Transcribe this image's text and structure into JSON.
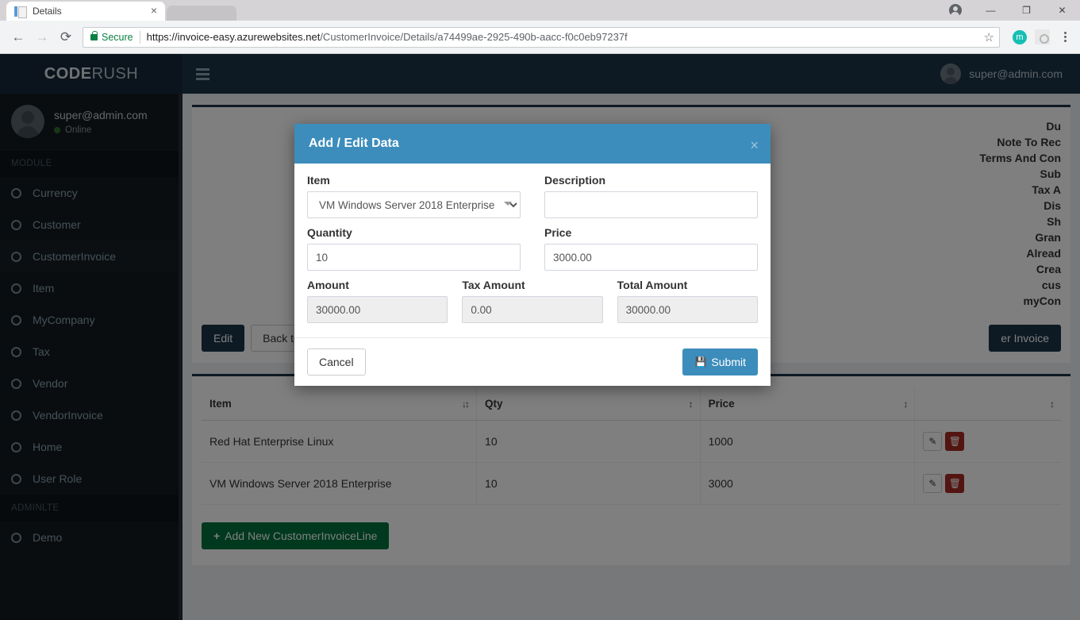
{
  "browser": {
    "tab_title": "Details",
    "tab_close": "×",
    "back_icon": "←",
    "forward_icon": "→",
    "reload_icon": "⟳",
    "secure_label": "Secure",
    "url_scheme_host": "https://invoice-easy.azurewebsites.net",
    "url_path": "/CustomerInvoice/Details/a74499ae-2925-490b-aacc-f0c0eb97237f",
    "star_icon": "☆",
    "extension_letter": "m",
    "window_minimize": "—",
    "window_maximize": "❐",
    "window_close": "✕"
  },
  "navbar": {
    "logo_bold": "CODE",
    "logo_light": "RUSH",
    "user_email": "super@admin.com"
  },
  "sidebar": {
    "user_name": "super@admin.com",
    "user_status": "Online",
    "section_module": "MODULE",
    "section_adminlte": "ADMINLTE",
    "items": [
      {
        "label": "Currency",
        "active": false
      },
      {
        "label": "Customer",
        "active": false
      },
      {
        "label": "CustomerInvoice",
        "active": true
      },
      {
        "label": "Item",
        "active": false
      },
      {
        "label": "MyCompany",
        "active": false
      },
      {
        "label": "Tax",
        "active": false
      },
      {
        "label": "Vendor",
        "active": false
      },
      {
        "label": "VendorInvoice",
        "active": false
      },
      {
        "label": "Home",
        "active": false
      },
      {
        "label": "User Role",
        "active": false
      }
    ],
    "demo_items": [
      {
        "label": "Demo",
        "active": false
      }
    ]
  },
  "details": {
    "labels": [
      "Du",
      "Note To Rec",
      "Terms And Con",
      "Sub",
      "Tax A",
      "Dis",
      "Sh",
      "Gran",
      "Alread",
      "Crea",
      "cus",
      "myCon"
    ],
    "buttons": {
      "edit": "Edit",
      "back_to_list": "Back to Li",
      "customer_invoice": "er Invoice"
    }
  },
  "lines_table": {
    "columns": [
      "Item",
      "Qty",
      "Price",
      ""
    ],
    "sort_icon_active": "↓↕",
    "sort_icon": "↕",
    "rows": [
      {
        "item": "Red Hat Enterprise Linux",
        "qty": "10",
        "price": "1000"
      },
      {
        "item": "VM Windows Server 2018 Enterprise",
        "qty": "10",
        "price": "3000"
      }
    ],
    "edit_icon": "✎",
    "delete_icon": "🗑",
    "add_button": "Add New CustomerInvoiceLine",
    "add_icon": "+"
  },
  "modal": {
    "title": "Add / Edit Data",
    "close_icon": "×",
    "fields": {
      "item_label": "Item",
      "item_value": "VM Windows Server 2018 Enterprise",
      "description_label": "Description",
      "description_value": "",
      "description_placeholder": "",
      "quantity_label": "Quantity",
      "quantity_value": "10",
      "price_label": "Price",
      "price_value": "3000.00",
      "amount_label": "Amount",
      "amount_value": "30000.00",
      "tax_amount_label": "Tax Amount",
      "tax_amount_value": "0.00",
      "total_amount_label": "Total Amount",
      "total_amount_value": "30000.00"
    },
    "cancel_label": "Cancel",
    "submit_label": "Submit",
    "submit_icon": "💾"
  },
  "colors": {
    "modal_header": "#3c8dbc",
    "navbar": "#1b3448",
    "sidebar": "#141a1f",
    "add_button": "#00733a",
    "delete_button": "#a72b23"
  }
}
